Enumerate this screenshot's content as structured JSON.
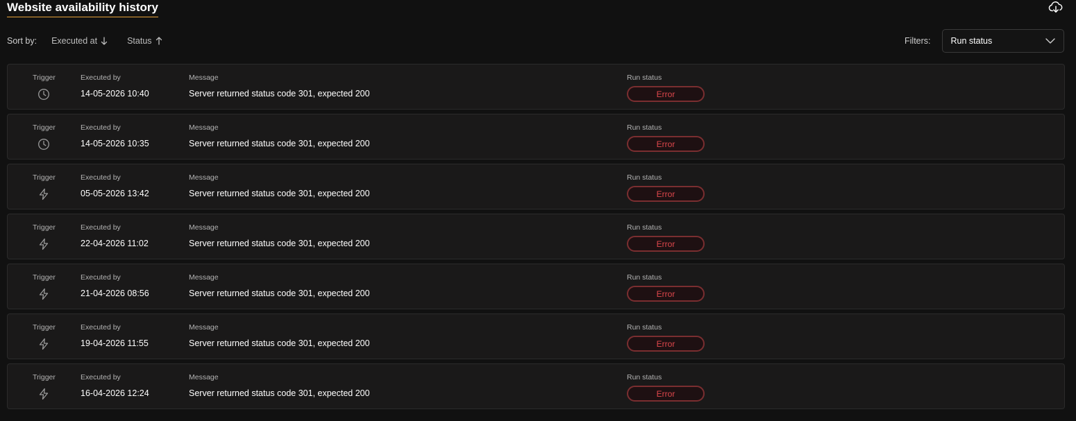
{
  "header": {
    "title": "Website availability history",
    "download_icon": "cloud-download-icon"
  },
  "sort": {
    "label": "Sort by:",
    "items": [
      {
        "label": "Executed at",
        "direction": "down",
        "icon": "arrow-down-icon"
      },
      {
        "label": "Status",
        "direction": "up",
        "icon": "arrow-up-icon"
      }
    ]
  },
  "filters": {
    "label": "Filters:",
    "select_value": "Run status",
    "select_icon": "chevron-down-icon"
  },
  "columns": {
    "trigger": "Trigger",
    "executed_by": "Executed by",
    "message": "Message",
    "run_status": "Run status"
  },
  "colors": {
    "background": "#111111",
    "row_background": "#1a1919",
    "accent_underline": "#e8a33a",
    "error": "#e0474c",
    "error_border": "#7a2e30"
  },
  "rows": [
    {
      "trigger_icon": "clock-icon",
      "executed_at": "14-05-2026 10:40",
      "message": "Server returned status code 301, expected 200",
      "status": "Error"
    },
    {
      "trigger_icon": "clock-icon",
      "executed_at": "14-05-2026 10:35",
      "message": "Server returned status code 301, expected 200",
      "status": "Error"
    },
    {
      "trigger_icon": "lightning-icon",
      "executed_at": "05-05-2026 13:42",
      "message": "Server returned status code 301, expected 200",
      "status": "Error"
    },
    {
      "trigger_icon": "lightning-icon",
      "executed_at": "22-04-2026 11:02",
      "message": "Server returned status code 301, expected 200",
      "status": "Error"
    },
    {
      "trigger_icon": "lightning-icon",
      "executed_at": "21-04-2026 08:56",
      "message": "Server returned status code 301, expected 200",
      "status": "Error"
    },
    {
      "trigger_icon": "lightning-icon",
      "executed_at": "19-04-2026 11:55",
      "message": "Server returned status code 301, expected 200",
      "status": "Error"
    },
    {
      "trigger_icon": "lightning-icon",
      "executed_at": "16-04-2026 12:24",
      "message": "Server returned status code 301, expected 200",
      "status": "Error"
    }
  ]
}
